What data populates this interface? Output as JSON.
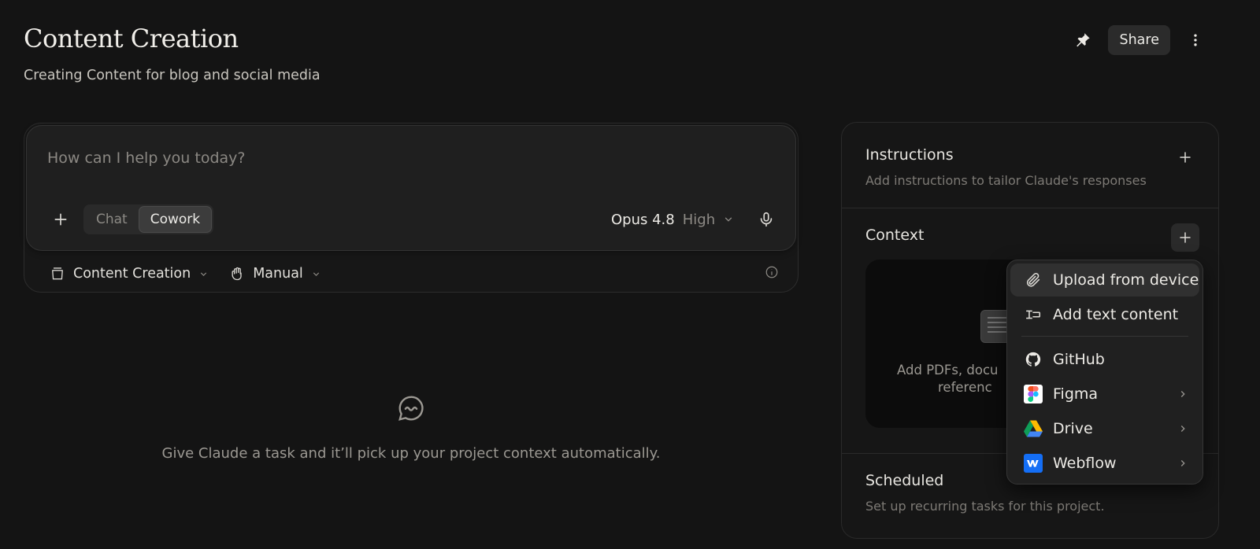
{
  "header": {
    "title": "Content Creation",
    "subtitle": "Creating Content for blog and social media",
    "share_label": "Share"
  },
  "composer": {
    "placeholder": "How can I help you today?",
    "modes": [
      "Chat",
      "Cowork"
    ],
    "active_mode": "Cowork",
    "model": "Opus 4.8",
    "effort": "High",
    "project": "Content Creation",
    "approval_mode": "Manual"
  },
  "empty_state": {
    "text": "Give Claude a task and it’ll pick up your project context automatically."
  },
  "side_panel": {
    "instructions": {
      "title": "Instructions",
      "description": "Add instructions to tailor Claude's responses"
    },
    "context": {
      "title": "Context",
      "drop_line1": "Add PDFs, docu",
      "drop_line2": "referenc"
    },
    "scheduled": {
      "title": "Scheduled",
      "description": "Set up recurring tasks for this project."
    }
  },
  "context_menu": {
    "items": [
      {
        "label": "Upload from device",
        "icon": "paperclip-icon"
      },
      {
        "label": "Add text content",
        "icon": "text-cursor-icon"
      },
      {
        "label": "GitHub",
        "icon": "github-icon"
      },
      {
        "label": "Figma",
        "icon": "figma-icon"
      },
      {
        "label": "Drive",
        "icon": "drive-icon"
      },
      {
        "label": "Webflow",
        "icon": "webflow-icon"
      }
    ]
  },
  "colors": {
    "background": "#141414",
    "panel": "#161616",
    "menu": "#202020",
    "webflow": "#146EF5"
  }
}
